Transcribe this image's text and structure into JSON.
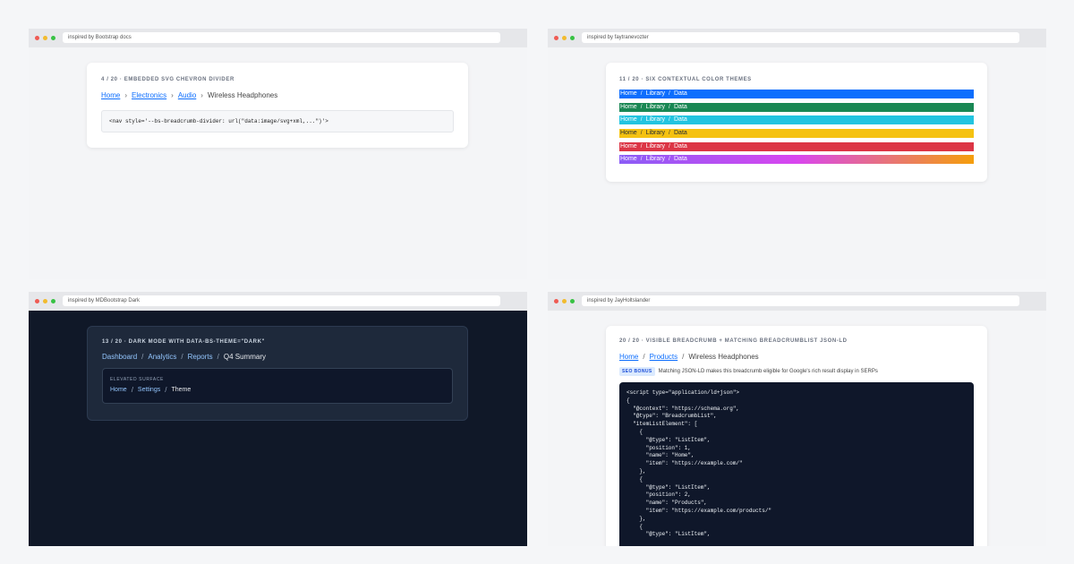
{
  "panels": [
    {
      "url": "inspired by Bootstrap docs",
      "eyebrow": "4 / 20 · EMBEDDED SVG CHEVRON DIVIDER",
      "breadcrumb": [
        "Home",
        "Electronics",
        "Audio",
        "Wireless Headphones"
      ],
      "divider_icon": "chevron-right",
      "code": "<nav style='--bs-breadcrumb-divider: url(\"data:image/svg+xml,...\")'>"
    },
    {
      "url": "inspired by faytranevozter",
      "eyebrow": "11 / 20 · SIX CONTEXTUAL COLOR THEMES",
      "themes": [
        {
          "items": [
            "Home",
            "Library",
            "Data"
          ],
          "bg": "#0d6efd",
          "fg": "#ffffff"
        },
        {
          "items": [
            "Home",
            "Library",
            "Data"
          ],
          "bg": "#198754",
          "fg": "#ffffff"
        },
        {
          "items": [
            "Home",
            "Library",
            "Data"
          ],
          "bg": "#22c4e0",
          "fg": "#ffffff"
        },
        {
          "items": [
            "Home",
            "Library",
            "Data"
          ],
          "bg": "#f5c211",
          "fg": "#1f2937"
        },
        {
          "items": [
            "Home",
            "Library",
            "Data"
          ],
          "bg": "#dc3545",
          "fg": "#ffffff"
        },
        {
          "items": [
            "Home",
            "Library",
            "Data"
          ],
          "bg": "linear-gradient(90deg,#8b5cf6,#d946ef,#f59e0b)",
          "fg": "#ffffff"
        }
      ],
      "separator": "/"
    },
    {
      "url": "inspired by MDBootstrap Dark",
      "eyebrow": "13 / 20 · DARK MODE WITH DATA-BS-THEME=\"DARK\"",
      "breadcrumb": [
        "Dashboard",
        "Analytics",
        "Reports",
        "Q4 Summary"
      ],
      "elevated_label": "ELEVATED SURFACE",
      "elevated_breadcrumb": [
        "Home",
        "Settings",
        "Theme"
      ],
      "separator": "/"
    },
    {
      "url": "inspired by JayHoltslander",
      "eyebrow": "20 / 20 · VISIBLE BREADCRUMB + MATCHING BREADCRUMBLIST JSON-LD",
      "breadcrumb": [
        "Home",
        "Products",
        "Wireless Headphones"
      ],
      "separator": "/",
      "badge": "SEO BONUS",
      "note": "Matching JSON-LD makes this breadcrumb eligible for Google's rich result display in SERPs",
      "code_lines": [
        "<script type=\"application/ld+json\">",
        "{",
        "  \"@context\": \"https://schema.org\",",
        "  \"@type\": \"BreadcrumbList\",",
        "  \"itemListElement\": [",
        "    {",
        "      \"@type\": \"ListItem\",",
        "      \"position\": 1,",
        "      \"name\": \"Home\",",
        "      \"item\": \"https://example.com/\"",
        "    },",
        "    {",
        "      \"@type\": \"ListItem\",",
        "      \"position\": 2,",
        "      \"name\": \"Products\",",
        "      \"item\": \"https://example.com/products/\"",
        "    },",
        "    {",
        "      \"@type\": \"ListItem\","
      ]
    }
  ],
  "colors": {
    "link": "#0d6efd",
    "dark_bg": "#101828",
    "dark_link": "#93c5fd"
  }
}
